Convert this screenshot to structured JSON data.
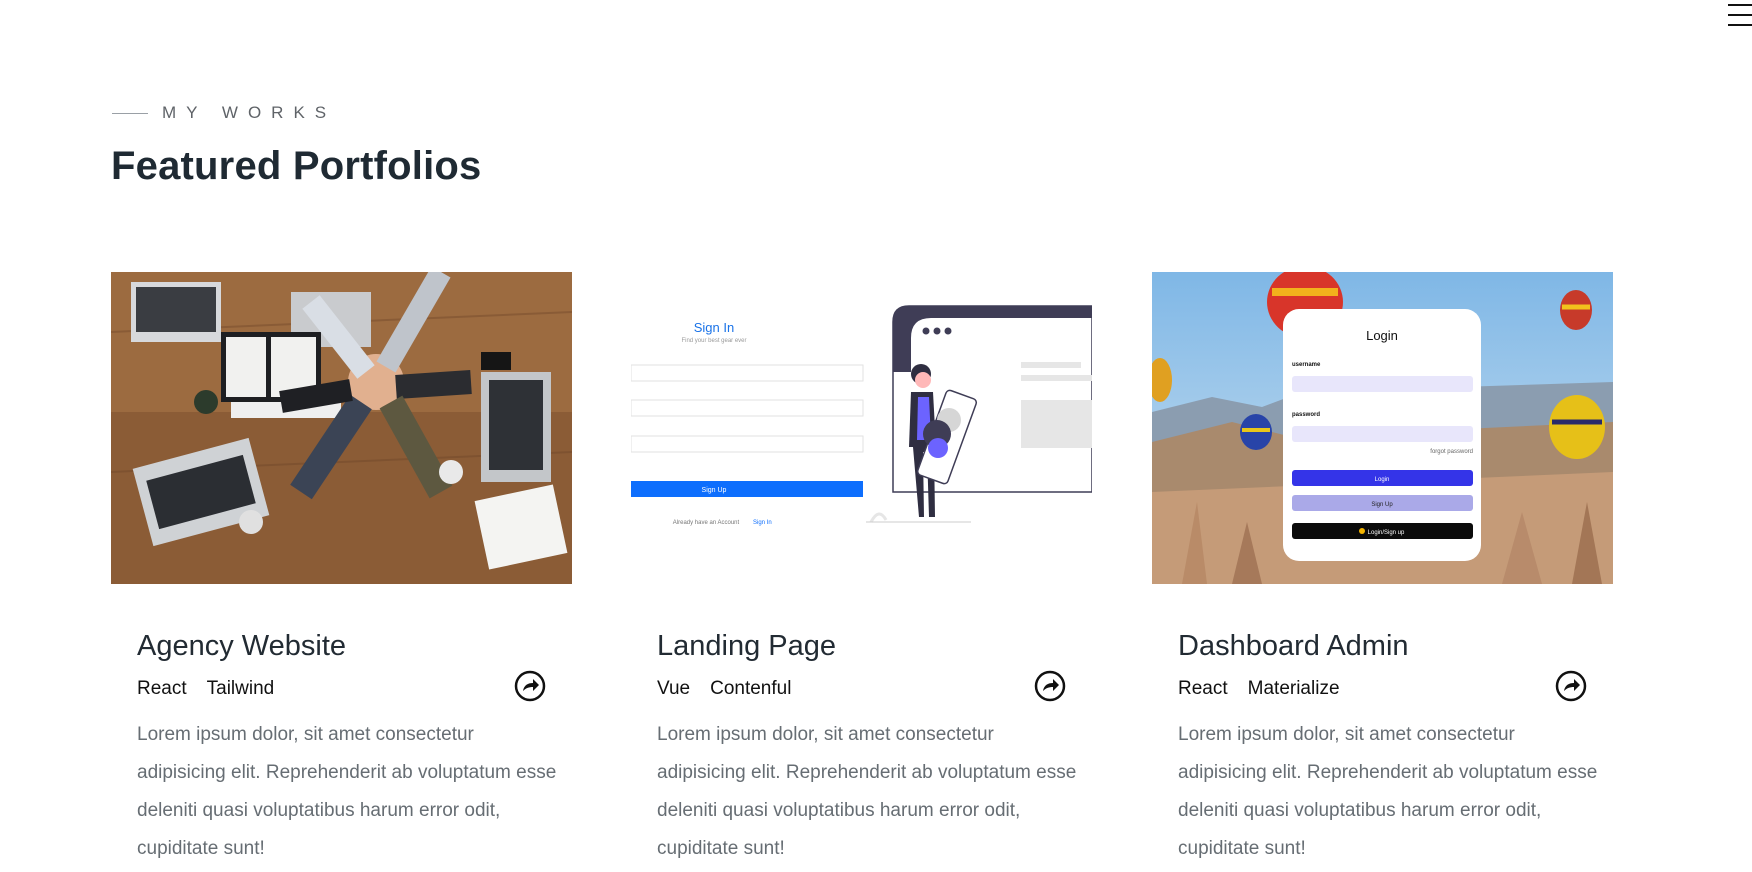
{
  "header": {
    "menu_icon": "hamburger-icon"
  },
  "section": {
    "eyebrow": "MY WORKS",
    "title": "Featured Portfolios"
  },
  "portfolios": [
    {
      "title": "Agency Website",
      "tags": [
        "React",
        "Tailwind"
      ],
      "description": "Lorem ipsum dolor, sit amet consectetur adipisicing elit. Reprehenderit ab voluptatum esse deleniti quasi voluptatibus harum error odit, cupiditate sunt!",
      "link_icon": "share-arrow-icon",
      "image": "team-hands-laptops-photo"
    },
    {
      "title": "Landing Page",
      "tags": [
        "Vue",
        "Contenful"
      ],
      "description": "Lorem ipsum dolor, sit amet consectetur adipisicing elit. Reprehenderit ab voluptatum esse deleniti quasi voluptatibus harum error odit, cupiditate sunt!",
      "link_icon": "share-arrow-icon",
      "image": "sign-in-illustration",
      "screenshot_text": {
        "heading": "Sign In",
        "subheading": "Find your best gear ever",
        "button": "Sign Up",
        "footer": "Already have an Account",
        "footer_link": "Sign In"
      }
    },
    {
      "title": "Dashboard Admin",
      "tags": [
        "React",
        "Materialize"
      ],
      "description": "Lorem ipsum dolor, sit amet consectetur adipisicing elit. Reprehenderit ab voluptatum esse deleniti quasi voluptatibus harum error odit, cupiditate sunt!",
      "link_icon": "share-arrow-icon",
      "image": "login-balloons-screenshot",
      "screenshot_text": {
        "heading": "Login",
        "username_label": "username",
        "password_label": "password",
        "forgot": "forgot password",
        "login_button": "Login",
        "signup_button": "Sign Up",
        "google_button": "Login/Sign up"
      }
    }
  ],
  "colors": {
    "title": "#1f2a33",
    "body_text": "#666d73",
    "accent_blue": "#0d6efd",
    "login_blue": "#3434e8"
  }
}
